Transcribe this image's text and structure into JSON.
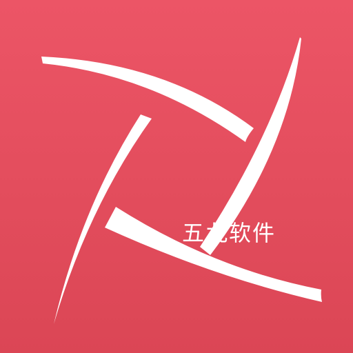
{
  "app_icon": {
    "brand_text": "五九软件",
    "background_top": "#ec5566",
    "background_bottom": "#db4655",
    "blade_color": "#ffffff",
    "emblem": "pinwheel-icon"
  }
}
